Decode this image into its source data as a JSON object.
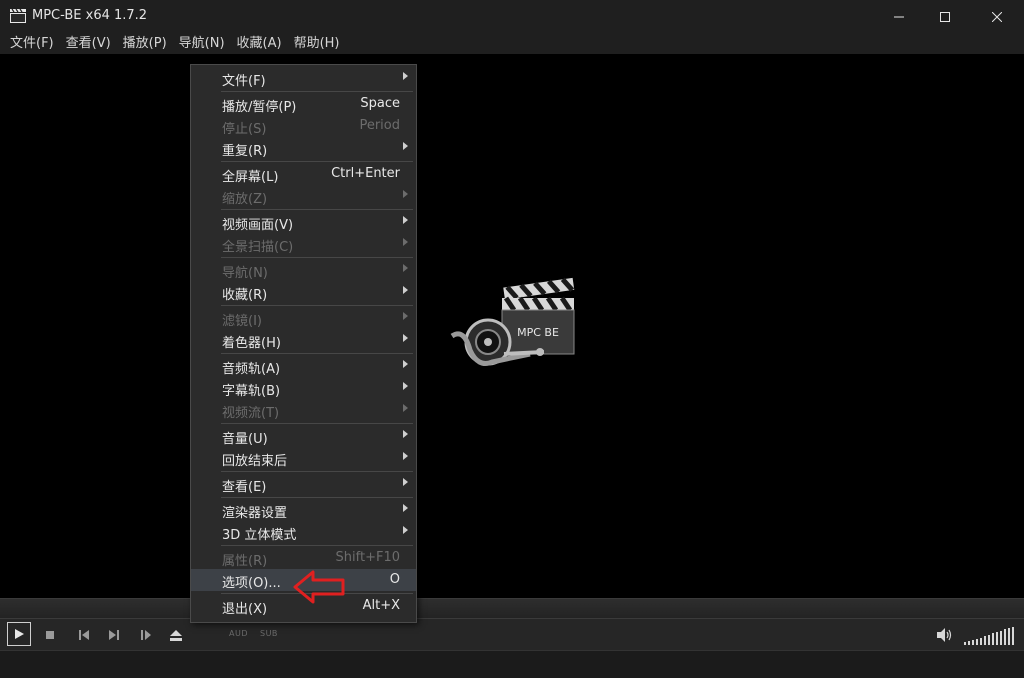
{
  "window": {
    "title": "MPC-BE x64 1.7.2"
  },
  "menubar": [
    "文件(F)",
    "查看(V)",
    "播放(P)",
    "导航(N)",
    "收藏(A)",
    "帮助(H)"
  ],
  "logo": {
    "text": "MPC BE"
  },
  "menu": {
    "items": [
      {
        "label": "文件(F)",
        "key": "",
        "submenu": true,
        "disabled": false
      },
      {
        "sep": true
      },
      {
        "label": "播放/暂停(P)",
        "key": "Space",
        "submenu": false,
        "disabled": false
      },
      {
        "label": "停止(S)",
        "key": "Period",
        "submenu": false,
        "disabled": true
      },
      {
        "label": "重复(R)",
        "key": "",
        "submenu": true,
        "disabled": false
      },
      {
        "sep": true
      },
      {
        "label": "全屏幕(L)",
        "key": "Ctrl+Enter",
        "submenu": false,
        "disabled": false
      },
      {
        "label": "缩放(Z)",
        "key": "",
        "submenu": true,
        "disabled": true
      },
      {
        "sep": true
      },
      {
        "label": "视频画面(V)",
        "key": "",
        "submenu": true,
        "disabled": false
      },
      {
        "label": "全景扫描(C)",
        "key": "",
        "submenu": true,
        "disabled": true
      },
      {
        "sep": true
      },
      {
        "label": "导航(N)",
        "key": "",
        "submenu": true,
        "disabled": true
      },
      {
        "label": "收藏(R)",
        "key": "",
        "submenu": true,
        "disabled": false
      },
      {
        "sep": true
      },
      {
        "label": "滤镜(I)",
        "key": "",
        "submenu": true,
        "disabled": true
      },
      {
        "label": "着色器(H)",
        "key": "",
        "submenu": true,
        "disabled": false
      },
      {
        "sep": true
      },
      {
        "label": "音频轨(A)",
        "key": "",
        "submenu": true,
        "disabled": false
      },
      {
        "label": "字幕轨(B)",
        "key": "",
        "submenu": true,
        "disabled": false
      },
      {
        "label": "视频流(T)",
        "key": "",
        "submenu": true,
        "disabled": true
      },
      {
        "sep": true
      },
      {
        "label": "音量(U)",
        "key": "",
        "submenu": true,
        "disabled": false
      },
      {
        "label": "回放结束后",
        "key": "",
        "submenu": true,
        "disabled": false
      },
      {
        "sep": true
      },
      {
        "label": "查看(E)",
        "key": "",
        "submenu": true,
        "disabled": false
      },
      {
        "sep": true
      },
      {
        "label": "渲染器设置",
        "key": "",
        "submenu": true,
        "disabled": false
      },
      {
        "label": "3D 立体模式",
        "key": "",
        "submenu": true,
        "disabled": false
      },
      {
        "sep": true
      },
      {
        "label": "属性(R)",
        "key": "Shift+F10",
        "submenu": false,
        "disabled": true
      },
      {
        "label": "选项(O)...",
        "key": "O",
        "submenu": false,
        "disabled": false,
        "highlighted": true
      },
      {
        "sep": true
      },
      {
        "label": "退出(X)",
        "key": "Alt+X",
        "submenu": false,
        "disabled": false
      }
    ]
  },
  "controls": {
    "tags": [
      "AUD",
      "SUB"
    ]
  },
  "colors": {
    "highlight": "#3d4147",
    "arrow": "#e02020",
    "disabled_text": "#6c6c6c"
  }
}
